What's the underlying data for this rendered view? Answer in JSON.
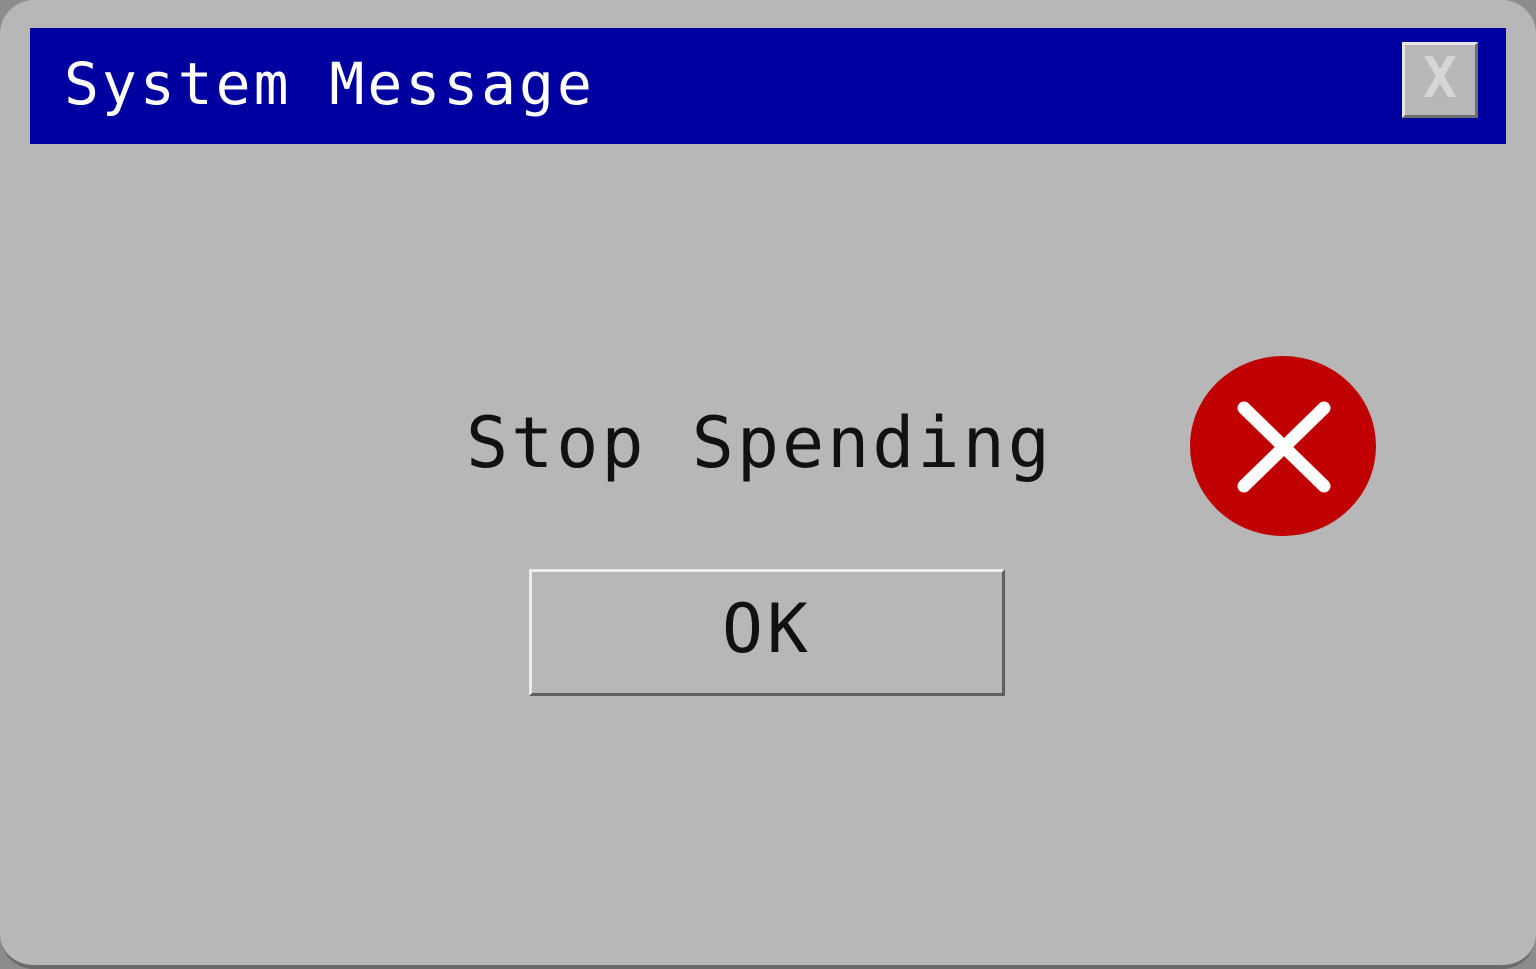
{
  "window": {
    "title": "System Message",
    "close_label": "X"
  },
  "dialog": {
    "message": "Stop Spending",
    "icon": "error-x-icon",
    "ok_label": "OK"
  },
  "colors": {
    "title_bar": "#0000a0",
    "dialog_background": "#b7b7b7",
    "error_icon": "#c00000"
  }
}
